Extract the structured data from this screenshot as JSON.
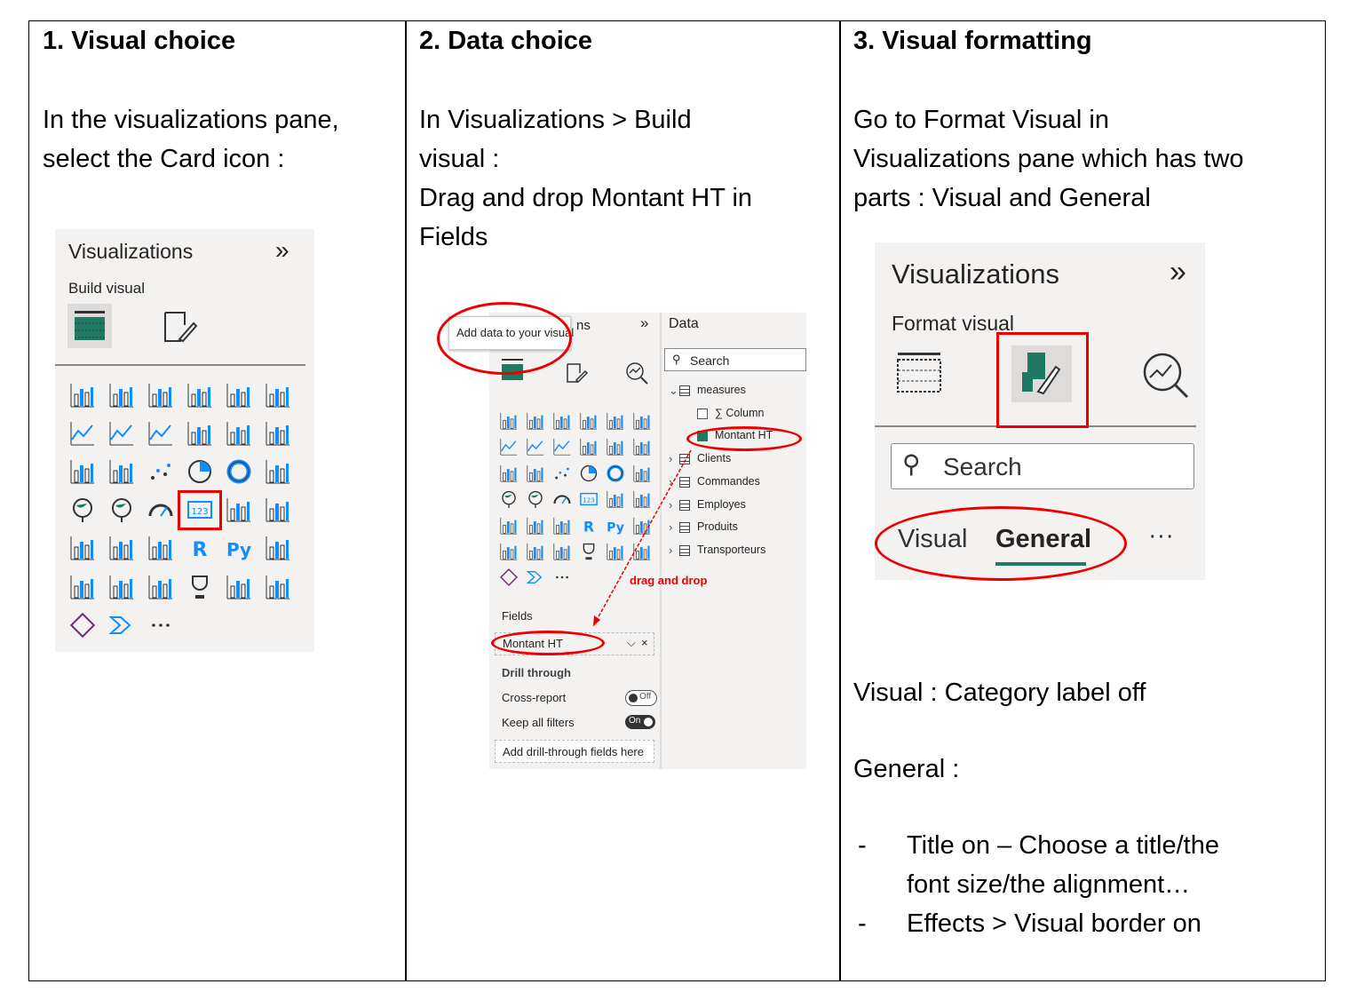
{
  "columns": [
    {
      "heading": "1. Visual choice",
      "lines": [
        "In the visualizations pane,",
        "select the Card icon :"
      ],
      "pane": {
        "title": "Visualizations",
        "subtitle": "Build visual",
        "chevrons": "»",
        "more": "···"
      }
    },
    {
      "heading": "2. Data choice",
      "lines": [
        "In  Visualizations > Build",
        "visual :",
        "Drag and drop Montant HT in",
        "Fields"
      ],
      "pane": {
        "tooltip": "Add data to your visual",
        "title_partial": "ns",
        "build_partial": "B   d visual",
        "data_title": "Data",
        "search": "Search",
        "tree": [
          "measures",
          "Column",
          "Montant HT",
          "Clients",
          "Commandes",
          "Employes",
          "Produits",
          "Transporteurs"
        ],
        "drag_label": "drag and drop",
        "fields_label": "Fields",
        "field_value": "Montant HT",
        "drill_title": "Drill through",
        "cross_report": "Cross-report",
        "cross_state": "Off",
        "keep_filters": "Keep all filters",
        "keep_state": "On",
        "drill_placeholder": "Add drill-through fields here",
        "more": "···"
      }
    },
    {
      "heading": "3. Visual formatting",
      "lines": [
        "Go to Format Visual in",
        "Visualizations pane which has two",
        "parts : Visual and General"
      ],
      "pane": {
        "title": "Visualizations",
        "subtitle": "Format visual",
        "search": "Search",
        "tab_visual": "Visual",
        "tab_general": "General",
        "more": "···"
      },
      "notes": [
        "Visual : Category label off",
        "General :"
      ],
      "bullets": [
        {
          "dash": "-",
          "lines": [
            "Title on – Choose a title/the",
            "font size/the alignment…"
          ]
        },
        {
          "dash": "-",
          "lines": [
            "Effects > Visual border on"
          ]
        }
      ]
    }
  ],
  "colors": {
    "accent_red": "#e00000",
    "icon_blue": "#118dff",
    "pane_bg": "#f3f2f1",
    "teal": "#1f7a63"
  }
}
